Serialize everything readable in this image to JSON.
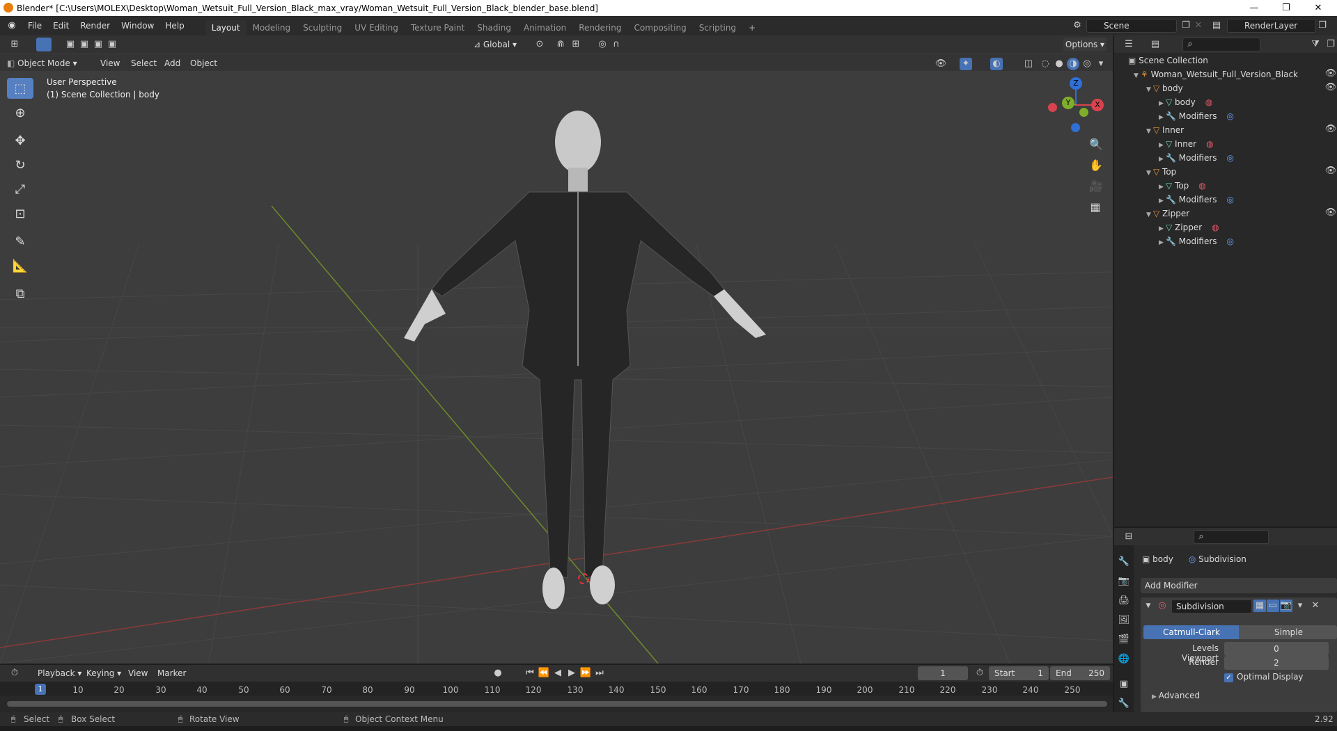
{
  "window": {
    "title": "Blender* [C:\\Users\\MOLEX\\Desktop\\Woman_Wetsuit_Full_Version_Black_max_vray/Woman_Wetsuit_Full_Version_Black_blender_base.blend]"
  },
  "menus": [
    "File",
    "Edit",
    "Render",
    "Window",
    "Help"
  ],
  "workspaces": [
    "Layout",
    "Modeling",
    "Sculpting",
    "UV Editing",
    "Texture Paint",
    "Shading",
    "Animation",
    "Rendering",
    "Compositing",
    "Scripting"
  ],
  "scene": {
    "name": "Scene",
    "render_layer": "RenderLayer"
  },
  "viewport": {
    "mode": "Object Mode",
    "menus": [
      "View",
      "Select",
      "Add",
      "Object"
    ],
    "orientation": "Global",
    "options_label": "Options",
    "overlay_title": "User Perspective",
    "overlay_sub": "(1) Scene Collection | body",
    "gizmo": {
      "z": "Z",
      "y": "Y",
      "x": "X"
    }
  },
  "outliner": {
    "root": "Scene Collection",
    "collection": "Woman_Wetsuit_Full_Version_Black",
    "objects": [
      {
        "name": "body",
        "mesh": "body",
        "mods": "Modifiers"
      },
      {
        "name": "Inner",
        "mesh": "Inner",
        "mods": "Modifiers"
      },
      {
        "name": "Top",
        "mesh": "Top",
        "mods": "Modifiers"
      },
      {
        "name": "Zipper",
        "mesh": "Zipper",
        "mods": "Modifiers"
      }
    ]
  },
  "properties": {
    "object": "body",
    "modifier_tab": "Subdivision",
    "add_modifier": "Add Modifier",
    "modifier_name": "Subdivision",
    "type_catmull": "Catmull-Clark",
    "type_simple": "Simple",
    "levels_viewport_label": "Levels Viewport",
    "levels_viewport": "0",
    "render_label": "Render",
    "render_value": "2",
    "optimal_display": "Optimal Display",
    "advanced": "Advanced"
  },
  "timeline": {
    "menus": [
      "Playback",
      "Keying",
      "View",
      "Marker"
    ],
    "current_frame": "1",
    "start_label": "Start",
    "start": "1",
    "end_label": "End",
    "end": "250",
    "frames": [
      "10",
      "20",
      "30",
      "40",
      "50",
      "60",
      "70",
      "80",
      "90",
      "100",
      "110",
      "120",
      "130",
      "140",
      "150",
      "160",
      "170",
      "180",
      "190",
      "200",
      "210",
      "220",
      "230",
      "240",
      "250"
    ],
    "playhead": "1"
  },
  "statusbar": {
    "select": "Select",
    "box_select": "Box Select",
    "rotate": "Rotate View",
    "context": "Object Context Menu",
    "version": "2.92"
  }
}
